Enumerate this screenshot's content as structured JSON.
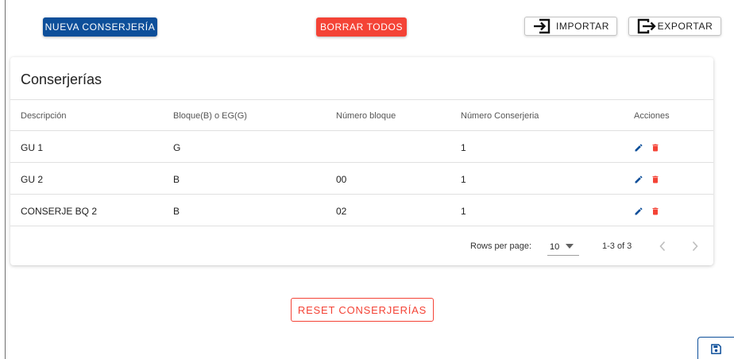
{
  "toolbar": {
    "new_label": "NUEVA CONSERJERÍA",
    "delete_all_label": "BORRAR TODOS",
    "import_label": "IMPORTAR",
    "export_label": "EXPORTAR"
  },
  "card": {
    "title": "Conserjerías",
    "columns": [
      "Descripción",
      "Bloque(B) o EG(G)",
      "Número bloque",
      "Número Conserjeria",
      "Acciones"
    ],
    "rows": [
      {
        "descripcion": "GU 1",
        "bloque": "G",
        "numero_bloque": "",
        "numero_conserjeria": "1"
      },
      {
        "descripcion": "GU 2",
        "bloque": "B",
        "numero_bloque": "00",
        "numero_conserjeria": "1"
      },
      {
        "descripcion": "CONSERJE BQ 2",
        "bloque": "B",
        "numero_bloque": "02",
        "numero_conserjeria": "1"
      }
    ],
    "row_actions": [
      "edit-icon",
      "delete-icon"
    ]
  },
  "pagination": {
    "rows_per_page_label": "Rows per page:",
    "rows_per_page_value": "10",
    "range_label": "1-3 of 3"
  },
  "reset_label": "RESET CONSERJERÍAS",
  "fab_icon": "save-icon",
  "colors": {
    "primary": "#0d4f9a",
    "danger": "#f44336",
    "edit_icon": "#0d4f9a",
    "delete_icon": "#f44336"
  }
}
